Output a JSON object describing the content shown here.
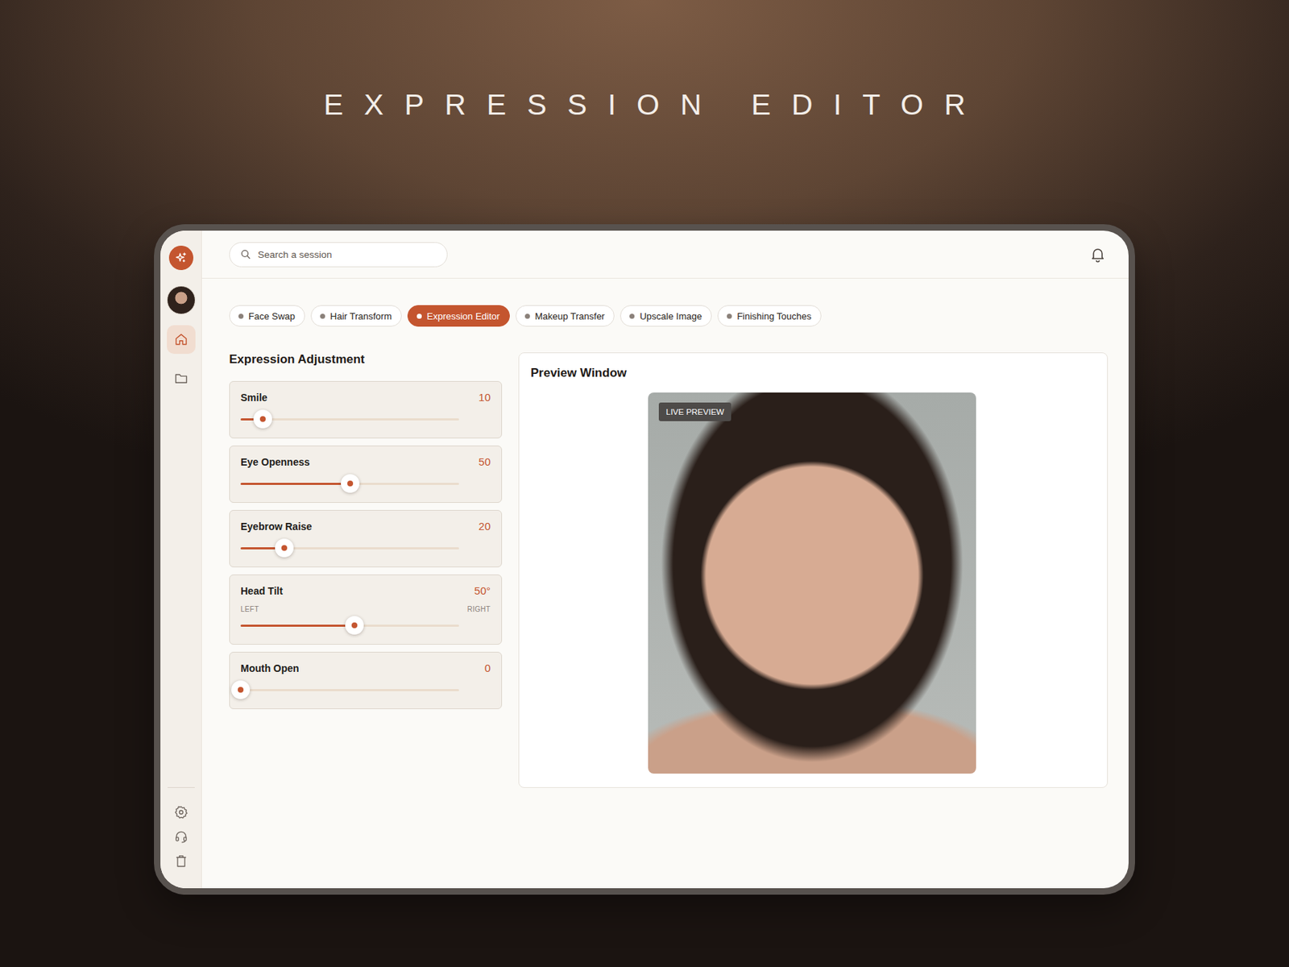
{
  "app": {
    "title": "EXPRESSION EDITOR"
  },
  "sidebar": {
    "nav": [
      {
        "selected": true
      },
      {
        "selected": false
      }
    ],
    "footer": [
      {
        "selected": false
      },
      {
        "selected": false
      },
      {
        "selected": false
      }
    ]
  },
  "search": {
    "placeholder": "Search a session"
  },
  "tabs": [
    {
      "label": "Face Swap",
      "selected": false
    },
    {
      "label": "Hair Transform",
      "selected": false
    },
    {
      "label": "Expression Editor",
      "selected": true
    },
    {
      "label": "Makeup Transfer",
      "selected": false
    },
    {
      "label": "Upscale Image",
      "selected": false
    },
    {
      "label": "Finishing Touches",
      "selected": false
    }
  ],
  "adjustments": {
    "title": "Expression Adjustment",
    "sliders": [
      {
        "kind": "plain",
        "label": "Smile",
        "reading": "10",
        "level": 0.1
      },
      {
        "kind": "plain",
        "label": "Eye Openness",
        "reading": "50",
        "level": 0.5
      },
      {
        "kind": "plain",
        "label": "Eyebrow Raise",
        "reading": "20",
        "level": 0.2
      },
      {
        "kind": "range",
        "label": "Head Tilt",
        "reading": "50°",
        "level": 0.52,
        "min_label": "LEFT",
        "max_label": "RIGHT"
      },
      {
        "kind": "plain",
        "label": "Mouth Open",
        "reading": "0",
        "level": 0
      }
    ]
  },
  "preview": {
    "title": "Preview Window",
    "badge": "LIVE PREVIEW"
  }
}
